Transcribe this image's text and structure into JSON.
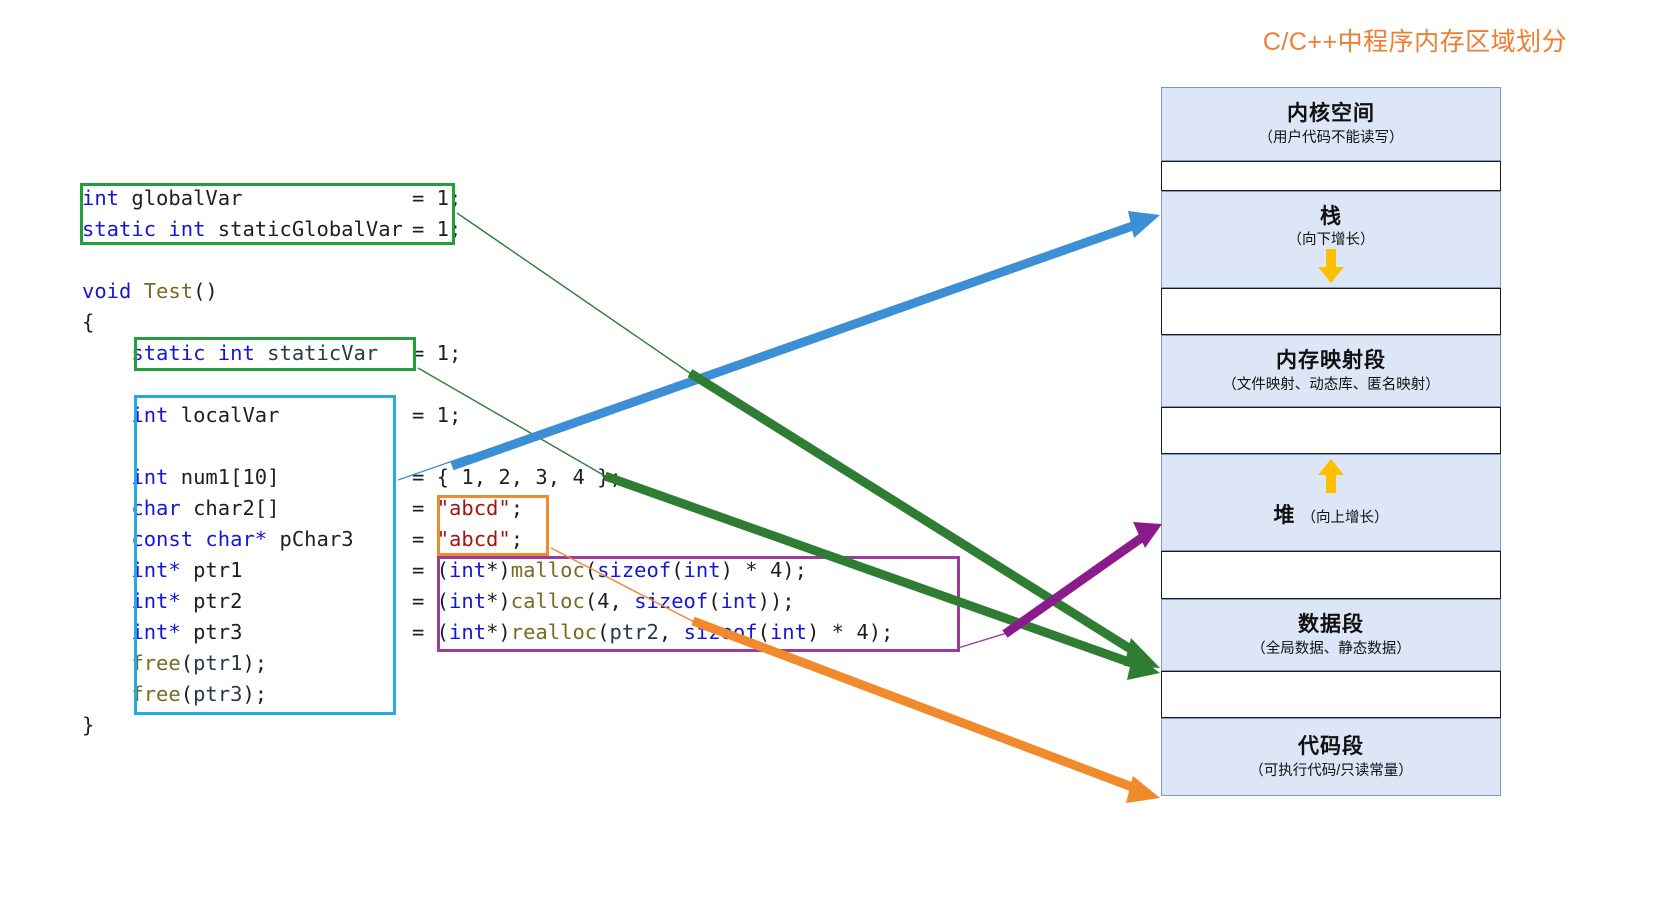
{
  "title": "C/C++中程序内存区域划分",
  "colors": {
    "title": "#ED7D31",
    "block_fill": "#DCE6F7",
    "block_border": "#7C9BC4",
    "gap_border": "#1a1a1a",
    "green_box": "#21A038",
    "blue_box": "#27AAE1",
    "orange_box": "#F08A2B",
    "purple_box": "#9B3C9B",
    "arrow_blue": "#3C8FD4",
    "arrow_green": "#2E7D32",
    "arrow_purple": "#8B1A8B",
    "arrow_orange": "#F08A2B",
    "growth_arrow": "#FFC000",
    "keyword": "#1616D8",
    "function": "#7B6A23",
    "string": "#A31515"
  },
  "code": {
    "lines": [
      {
        "decl": [
          {
            "t": "int ",
            "c": "kw"
          },
          {
            "t": "globalVar",
            "c": "plain"
          }
        ],
        "init": [
          {
            "t": "= 1;",
            "c": "plain"
          }
        ]
      },
      {
        "decl": [
          {
            "t": "static int ",
            "c": "kw"
          },
          {
            "t": "staticGlobalVar",
            "c": "plain"
          }
        ],
        "init": [
          {
            "t": "= 1;",
            "c": "plain"
          }
        ]
      },
      {
        "decl": [],
        "init": []
      },
      {
        "decl": [
          {
            "t": "void ",
            "c": "kw"
          },
          {
            "t": "Test",
            "c": "fn"
          },
          {
            "t": "()",
            "c": "plain"
          }
        ],
        "init": []
      },
      {
        "decl": [
          {
            "t": "{",
            "c": "plain"
          }
        ],
        "init": []
      },
      {
        "decl": [
          {
            "t": "    static int ",
            "c": "kw"
          },
          {
            "t": "staticVar",
            "c": "var"
          }
        ],
        "init": [
          {
            "t": "= 1;",
            "c": "plain"
          }
        ]
      },
      {
        "decl": [],
        "init": []
      },
      {
        "decl": [
          {
            "t": "    int ",
            "c": "kw"
          },
          {
            "t": "localVar",
            "c": "plain"
          }
        ],
        "init": [
          {
            "t": "= 1;",
            "c": "plain"
          }
        ]
      },
      {
        "decl": [],
        "init": []
      },
      {
        "decl": [
          {
            "t": "    int ",
            "c": "kw"
          },
          {
            "t": "num1[10]",
            "c": "plain"
          }
        ],
        "init": [
          {
            "t": "= { 1, 2, 3, 4 };",
            "c": "plain"
          }
        ]
      },
      {
        "decl": [
          {
            "t": "    char ",
            "c": "kw"
          },
          {
            "t": "char2[]",
            "c": "plain"
          }
        ],
        "init": [
          {
            "t": "= ",
            "c": "plain"
          },
          {
            "t": "\"abcd\"",
            "c": "str"
          },
          {
            "t": ";",
            "c": "plain"
          }
        ]
      },
      {
        "decl": [
          {
            "t": "    const char* ",
            "c": "kw"
          },
          {
            "t": "pChar3",
            "c": "plain"
          }
        ],
        "init": [
          {
            "t": "= ",
            "c": "plain"
          },
          {
            "t": "\"abcd\"",
            "c": "str"
          },
          {
            "t": ";",
            "c": "plain"
          }
        ]
      },
      {
        "decl": [
          {
            "t": "    int* ",
            "c": "kw"
          },
          {
            "t": "ptr1",
            "c": "plain"
          }
        ],
        "init": [
          {
            "t": "= (",
            "c": "plain"
          },
          {
            "t": "int",
            "c": "kw"
          },
          {
            "t": "*)",
            "c": "plain"
          },
          {
            "t": "malloc",
            "c": "fn"
          },
          {
            "t": "(",
            "c": "plain"
          },
          {
            "t": "sizeof",
            "c": "kw"
          },
          {
            "t": "(",
            "c": "plain"
          },
          {
            "t": "int",
            "c": "kw"
          },
          {
            "t": ") * 4);",
            "c": "plain"
          }
        ]
      },
      {
        "decl": [
          {
            "t": "    int* ",
            "c": "kw"
          },
          {
            "t": "ptr2",
            "c": "plain"
          }
        ],
        "init": [
          {
            "t": "= (",
            "c": "plain"
          },
          {
            "t": "int",
            "c": "kw"
          },
          {
            "t": "*)",
            "c": "plain"
          },
          {
            "t": "calloc",
            "c": "fn"
          },
          {
            "t": "(4, ",
            "c": "plain"
          },
          {
            "t": "sizeof",
            "c": "kw"
          },
          {
            "t": "(",
            "c": "plain"
          },
          {
            "t": "int",
            "c": "kw"
          },
          {
            "t": "));",
            "c": "plain"
          }
        ]
      },
      {
        "decl": [
          {
            "t": "    int* ",
            "c": "kw"
          },
          {
            "t": "ptr3",
            "c": "plain"
          }
        ],
        "init": [
          {
            "t": "= (",
            "c": "plain"
          },
          {
            "t": "int",
            "c": "kw"
          },
          {
            "t": "*)",
            "c": "plain"
          },
          {
            "t": "realloc",
            "c": "fn"
          },
          {
            "t": "(",
            "c": "plain"
          },
          {
            "t": "ptr2",
            "c": "var"
          },
          {
            "t": ", ",
            "c": "plain"
          },
          {
            "t": "sizeof",
            "c": "kw"
          },
          {
            "t": "(",
            "c": "plain"
          },
          {
            "t": "int",
            "c": "kw"
          },
          {
            "t": ") * 4);",
            "c": "plain"
          }
        ]
      },
      {
        "decl": [
          {
            "t": "    ",
            "c": "plain"
          },
          {
            "t": "free",
            "c": "fn"
          },
          {
            "t": "(",
            "c": "plain"
          },
          {
            "t": "ptr1",
            "c": "var"
          },
          {
            "t": ");",
            "c": "plain"
          }
        ],
        "init": []
      },
      {
        "decl": [
          {
            "t": "    ",
            "c": "plain"
          },
          {
            "t": "free",
            "c": "fn"
          },
          {
            "t": "(",
            "c": "plain"
          },
          {
            "t": "ptr3",
            "c": "var"
          },
          {
            "t": ");",
            "c": "plain"
          }
        ],
        "init": []
      },
      {
        "decl": [
          {
            "t": "}",
            "c": "plain"
          }
        ],
        "init": []
      }
    ]
  },
  "memory": {
    "blocks": [
      {
        "name": "kernel",
        "title": "内核空间",
        "sub": "（用户代码不能读写）",
        "inline": false,
        "grow": "none"
      },
      {
        "name": "stack",
        "title": "栈",
        "sub": "（向下增长）",
        "inline": false,
        "grow": "down"
      },
      {
        "name": "mmap",
        "title": "内存映射段",
        "sub": "（文件映射、动态库、匿名映射）",
        "inline": false,
        "grow": "none"
      },
      {
        "name": "heap",
        "title": "堆",
        "sub": "（向上增长）",
        "inline": true,
        "grow": "up"
      },
      {
        "name": "data",
        "title": "数据段",
        "sub": "（全局数据、静态数据）",
        "inline": false,
        "grow": "none"
      },
      {
        "name": "text",
        "title": "代码段",
        "sub": "（可执行代码/只读常量）",
        "inline": false,
        "grow": "none"
      }
    ]
  },
  "connectors": [
    {
      "name": "globals-to-data",
      "color": "#2E7D32",
      "note": "全局变量与静态全局变量指向数据段"
    },
    {
      "name": "staticvar-to-data",
      "color": "#2E7D32",
      "note": "静态局部变量指向数据段"
    },
    {
      "name": "locals-to-stack",
      "color": "#3C8FD4",
      "note": "局部变量指向栈"
    },
    {
      "name": "malloc-to-heap",
      "color": "#8B1A8B",
      "note": "动态分配内存指向堆"
    },
    {
      "name": "stringlit-to-text",
      "color": "#F08A2B",
      "note": "字符串常量指向代码段"
    }
  ]
}
